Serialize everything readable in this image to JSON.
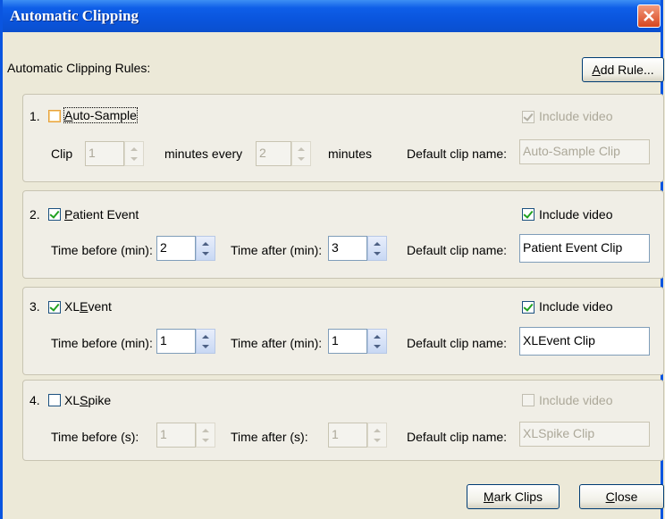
{
  "window": {
    "title": "Automatic Clipping"
  },
  "header": {
    "rules_label": "Automatic Clipping Rules:",
    "add_rule_prefix": "A",
    "add_rule_rest": "dd Rule..."
  },
  "rules": [
    {
      "num": "1.",
      "name_pre": "",
      "name_ul": "A",
      "name_post": "uto-Sample",
      "enabled": false,
      "include_video_label": "Include video",
      "include_video": true,
      "clip_label": "Clip",
      "clip_value": "1",
      "every_label": "minutes every",
      "every_value": "2",
      "minutes_label": "minutes",
      "default_label": "Default clip name:",
      "default_value": "Auto-Sample Clip"
    },
    {
      "num": "2.",
      "name_pre": "",
      "name_ul": "P",
      "name_post": "atient Event",
      "enabled": true,
      "include_video_label": "Include video",
      "include_video": true,
      "before_label": "Time before (min):",
      "before_value": "2",
      "after_label": "Time after (min):",
      "after_value": "3",
      "default_label": "Default clip name:",
      "default_value": "Patient Event Clip"
    },
    {
      "num": "3.",
      "name_pre": "XL",
      "name_ul": "E",
      "name_post": "vent",
      "enabled": true,
      "include_video_label": "Include video",
      "include_video": true,
      "before_label": "Time before (min):",
      "before_value": "1",
      "after_label": "Time after (min):",
      "after_value": "1",
      "default_label": "Default clip name:",
      "default_value": "XLEvent Clip"
    },
    {
      "num": "4.",
      "name_pre": "XL",
      "name_ul": "S",
      "name_post": "pike",
      "enabled": false,
      "include_video_label": "Include video",
      "include_video": false,
      "before_label": "Time before (s):",
      "before_value": "1",
      "after_label": "Time after (s):",
      "after_value": "1",
      "default_label": "Default clip name:",
      "default_value": "XLSpike Clip"
    }
  ],
  "footer": {
    "mark_clips_ul": "M",
    "mark_clips_rest": "ark Clips",
    "close_ul": "C",
    "close_rest": "lose"
  },
  "colors": {
    "titlebar": "#0a55dd",
    "dialog_bg": "#ece9d8",
    "check": "#21a121"
  },
  "icons": {
    "close": "close-icon",
    "spin": "spin-arrows-icon",
    "check": "checkmark-icon"
  }
}
